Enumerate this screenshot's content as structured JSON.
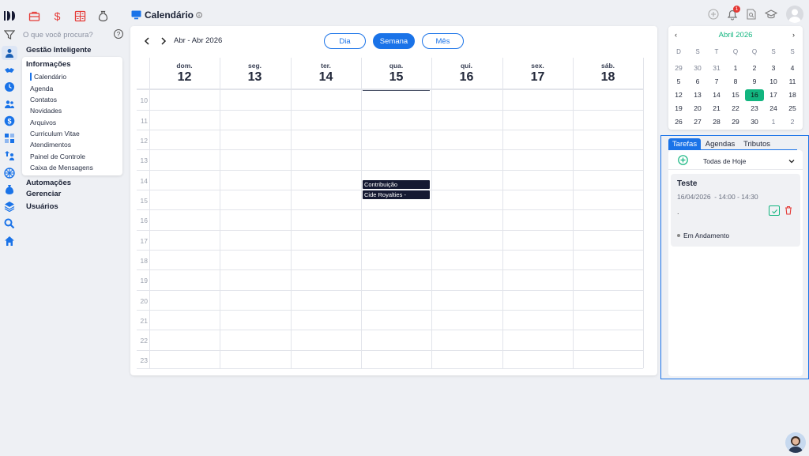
{
  "app": {
    "page_title": "Calendário",
    "info_icon": "info-icon"
  },
  "search": {
    "placeholder": "O que você procura?"
  },
  "nav": {
    "gestao": "Gestão Inteligente",
    "informacoes": "Informações",
    "sub_items": [
      "Calendário",
      "Agenda",
      "Contatos",
      "Novidades",
      "Arquivos",
      "Curriculum Vitae",
      "Atendimentos",
      "Painel de Controle",
      "Caixa de Mensagens"
    ],
    "automacoes": "Automações",
    "gerenciar": "Gerenciar",
    "usuarios": "Usuários"
  },
  "calendar": {
    "range": "Abr - Abr 2026",
    "views": [
      "Dia",
      "Semana",
      "Mês"
    ],
    "selected_view": "Semana",
    "days": [
      {
        "name": "dom.",
        "num": "12"
      },
      {
        "name": "seg.",
        "num": "13"
      },
      {
        "name": "ter.",
        "num": "14"
      },
      {
        "name": "qua.",
        "num": "15"
      },
      {
        "name": "qui.",
        "num": "16"
      },
      {
        "name": "sex.",
        "num": "17"
      },
      {
        "name": "sáb.",
        "num": "18"
      }
    ],
    "hours": [
      "10",
      "11",
      "12",
      "13",
      "14",
      "15",
      "16",
      "17",
      "18",
      "19",
      "20",
      "21",
      "22",
      "23"
    ],
    "events": [
      {
        "title": "Contribuição",
        "day": "15",
        "hour": "14"
      },
      {
        "title": "Cide Royalties -",
        "day": "15",
        "hour": "15"
      }
    ]
  },
  "mini_calendar": {
    "month": "Abril 2026",
    "weekdays": [
      "D",
      "S",
      "T",
      "Q",
      "Q",
      "S",
      "S"
    ],
    "weeks": [
      [
        "29",
        "30",
        "31",
        "1",
        "2",
        "3",
        "4"
      ],
      [
        "5",
        "6",
        "7",
        "8",
        "9",
        "10",
        "11"
      ],
      [
        "12",
        "13",
        "14",
        "15",
        "16",
        "17",
        "18"
      ],
      [
        "19",
        "20",
        "21",
        "22",
        "23",
        "24",
        "25"
      ],
      [
        "26",
        "27",
        "28",
        "29",
        "30",
        "1",
        "2"
      ]
    ],
    "today": "16"
  },
  "side_panel": {
    "tabs": [
      "Tarefas",
      "Agendas",
      "Tributos"
    ],
    "selected_tab": "Tarefas",
    "filter": "Todas de Hoje",
    "task": {
      "title": "Teste",
      "datetime": "16/04/2026  - 14:00 - 14:30",
      "note": ".",
      "status": "Em Andamento"
    }
  },
  "notifications": {
    "count": "1"
  },
  "colors": {
    "accent": "#1a73e8",
    "today": "#12b57f",
    "event": "#151932",
    "danger": "#e53935"
  }
}
